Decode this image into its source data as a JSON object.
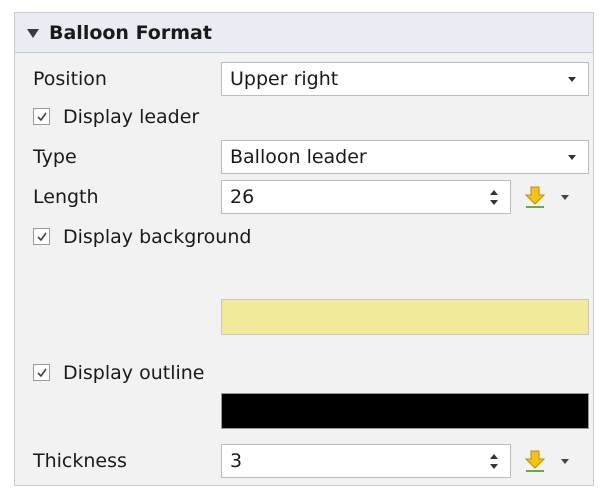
{
  "panel": {
    "title": "Balloon Format"
  },
  "position": {
    "label": "Position",
    "value": "Upper right"
  },
  "display_leader": {
    "label": "Display leader",
    "checked": true
  },
  "type": {
    "label": "Type",
    "value": "Balloon leader"
  },
  "length": {
    "label": "Length",
    "value": "26"
  },
  "display_background": {
    "label": "Display background",
    "checked": true,
    "color": "#f0ea9a"
  },
  "display_outline": {
    "label": "Display outline",
    "checked": true,
    "color": "#000000"
  },
  "thickness": {
    "label": "Thickness",
    "value": "3"
  },
  "icons": {
    "snap_button": "download-arrow-icon",
    "dropdown": "chevron-down-icon",
    "spinner": "spinner-icon",
    "checkbox": "check-icon"
  }
}
